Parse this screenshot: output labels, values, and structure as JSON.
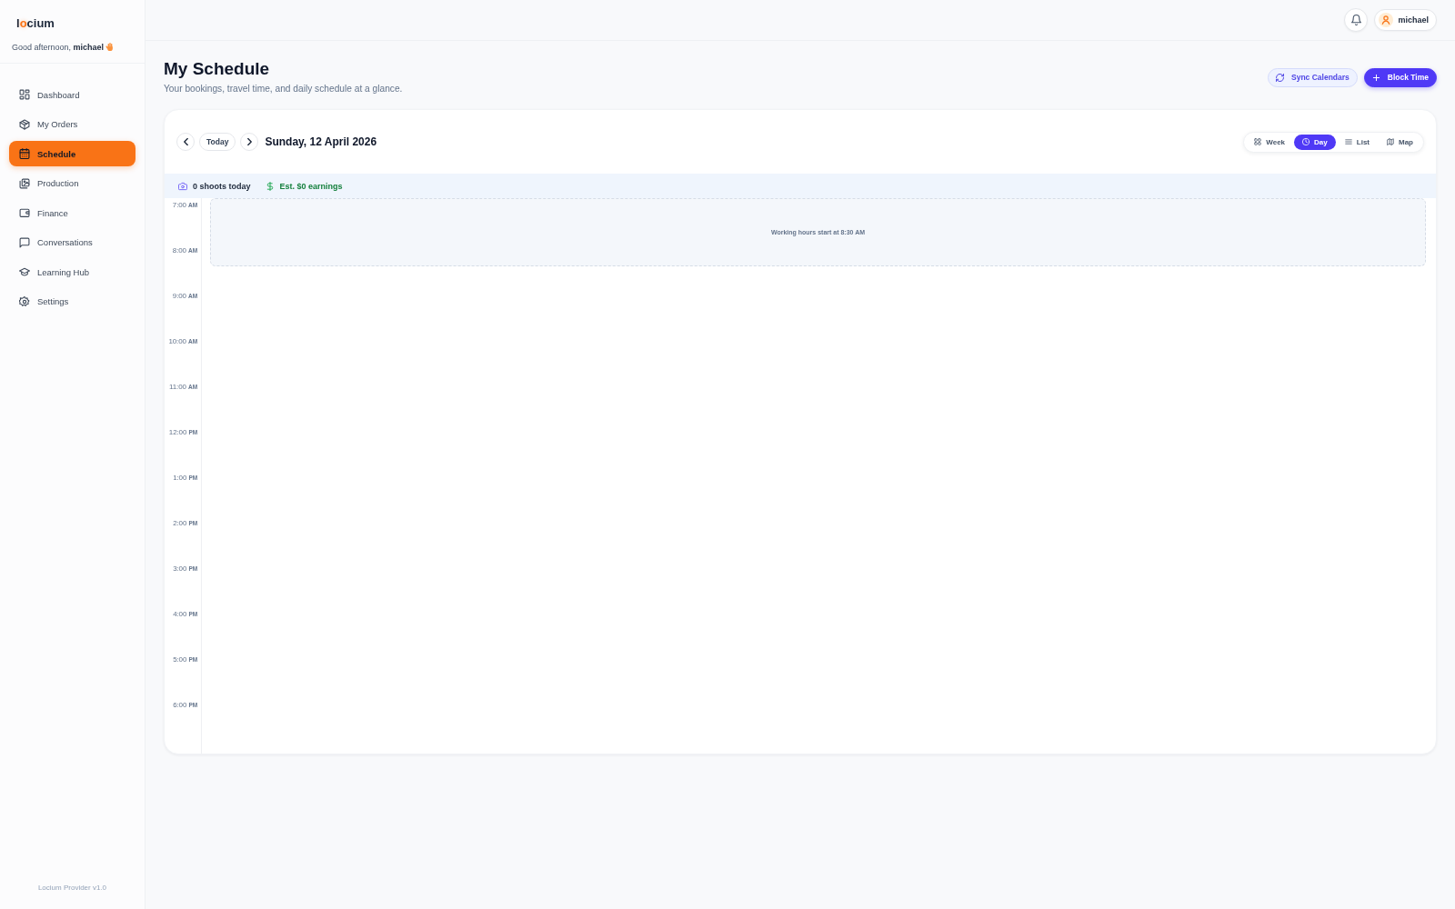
{
  "sidebar": {
    "logo": {
      "parts": [
        {
          "text": "l",
          "accent": false
        },
        {
          "text": "o",
          "accent": true
        },
        {
          "text": "cium",
          "accent": false
        }
      ]
    },
    "greeting": "Good afternoon, **michael**",
    "nav": [
      {
        "label": "Dashboard",
        "selected": false
      },
      {
        "label": "My Orders",
        "selected": false
      },
      {
        "label": "Schedule",
        "selected": true
      },
      {
        "label": "Production",
        "selected": false
      },
      {
        "label": "Finance",
        "selected": false
      },
      {
        "label": "Conversations",
        "selected": false
      },
      {
        "label": "Learning Hub",
        "selected": false
      },
      {
        "label": "Settings",
        "selected": false
      }
    ],
    "footer": "Locium Provider v1.0"
  },
  "topbar": {
    "user": {
      "name": "michael"
    }
  },
  "header": {
    "title": "My Schedule",
    "subtitle": "Your bookings, travel time, and daily schedule at a glance.",
    "actions": [
      {
        "label": "Sync Calendars",
        "kind": "secondary"
      },
      {
        "label": "Block Time",
        "kind": "primary"
      }
    ]
  },
  "calendar": {
    "today_button": "Today",
    "date": "Sunday, 12 April 2026",
    "views": [
      {
        "label": "Week",
        "selected": false
      },
      {
        "label": "Day",
        "selected": true
      },
      {
        "label": "List",
        "selected": false
      },
      {
        "label": "Map",
        "selected": false
      }
    ],
    "stats": [
      {
        "kind": "shoots",
        "text": "0 shoots today"
      },
      {
        "kind": "earnings",
        "text": "Est. $0 earnings"
      }
    ],
    "hours": [
      {
        "time": "7:00",
        "period": "AM"
      },
      {
        "time": "8:00",
        "period": "AM"
      },
      {
        "time": "9:00",
        "period": "AM"
      },
      {
        "time": "10:00",
        "period": "AM"
      },
      {
        "time": "11:00",
        "period": "AM"
      },
      {
        "time": "12:00",
        "period": "PM"
      },
      {
        "time": "1:00",
        "period": "PM"
      },
      {
        "time": "2:00",
        "period": "PM"
      },
      {
        "time": "3:00",
        "period": "PM"
      },
      {
        "time": "4:00",
        "period": "PM"
      },
      {
        "time": "5:00",
        "period": "PM"
      },
      {
        "time": "6:00",
        "period": "PM"
      }
    ],
    "working_hours_note": "Working hours start at 8:30 AM"
  }
}
